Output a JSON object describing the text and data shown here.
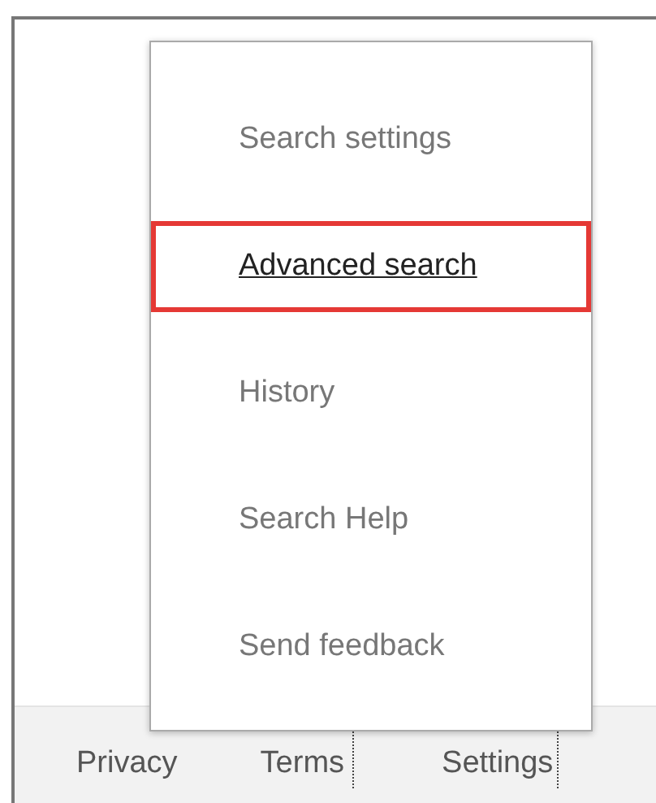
{
  "menu": {
    "items": [
      {
        "label": "Search settings",
        "selected": false
      },
      {
        "label": "Advanced search",
        "selected": true
      },
      {
        "label": "History",
        "selected": false
      },
      {
        "label": "Search Help",
        "selected": false
      },
      {
        "label": "Send feedback",
        "selected": false
      }
    ]
  },
  "footer": {
    "links": [
      "Privacy",
      "Terms",
      "Settings"
    ]
  }
}
